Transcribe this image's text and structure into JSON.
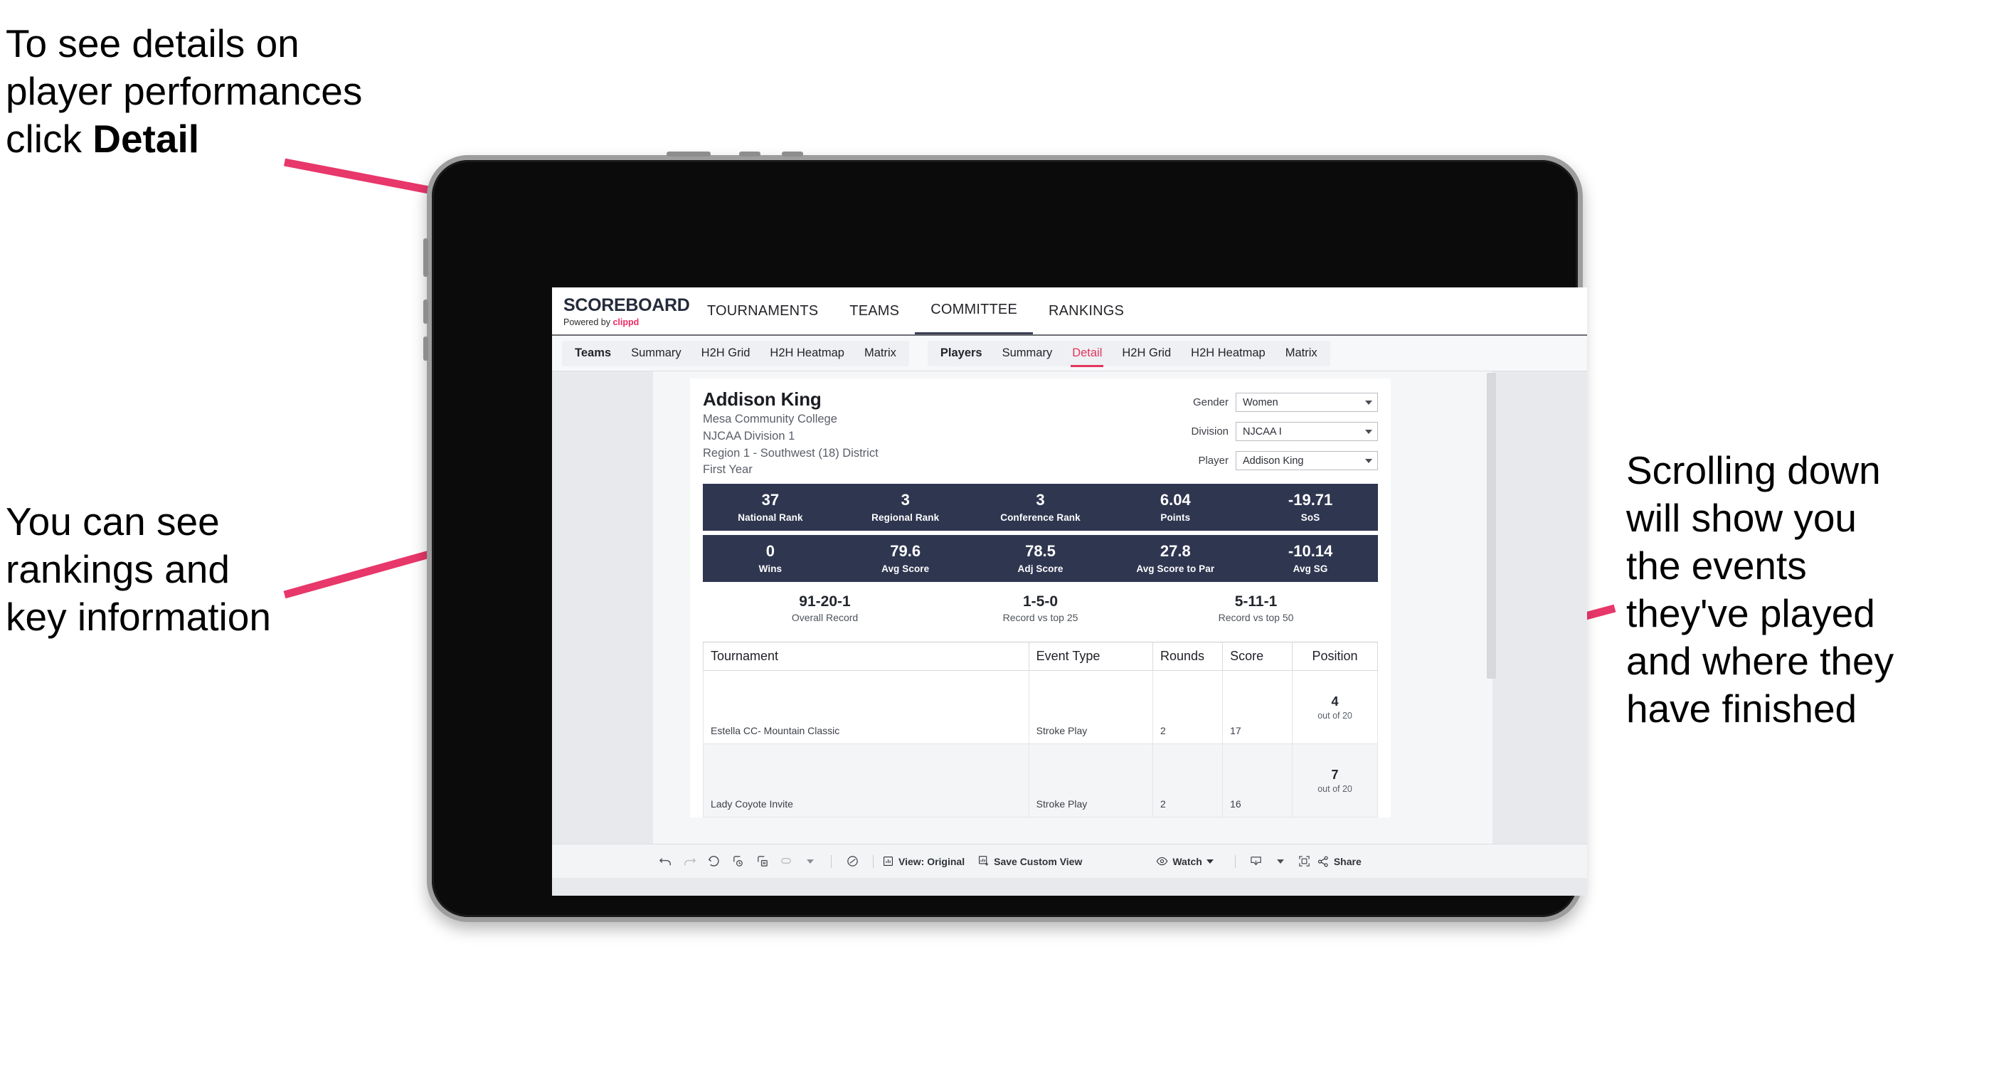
{
  "annotations": {
    "top_left": "To see details on\nplayer performances\nclick ",
    "top_left_bold": "Detail",
    "mid_left": "You can see\nrankings and\nkey information",
    "right": "Scrolling down\nwill show you\nthe events\nthey've played\nand where they\nhave finished",
    "arrow_color": "#e8376a"
  },
  "app": {
    "brand": {
      "title": "SCOREBOARD",
      "powered_prefix": "Powered by ",
      "powered_name": "clippd"
    },
    "topnav": [
      {
        "label": "TOURNAMENTS",
        "active": false
      },
      {
        "label": "TEAMS",
        "active": false
      },
      {
        "label": "COMMITTEE",
        "active": true
      },
      {
        "label": "RANKINGS",
        "active": false
      }
    ],
    "subnav": {
      "group_teams": [
        {
          "label": "Teams",
          "head": true,
          "active": false
        },
        {
          "label": "Summary",
          "head": false,
          "active": false
        },
        {
          "label": "H2H Grid",
          "head": false,
          "active": false
        },
        {
          "label": "H2H Heatmap",
          "head": false,
          "active": false
        },
        {
          "label": "Matrix",
          "head": false,
          "active": false
        }
      ],
      "group_players": [
        {
          "label": "Players",
          "head": true,
          "active": false
        },
        {
          "label": "Summary",
          "head": false,
          "active": false
        },
        {
          "label": "Detail",
          "head": false,
          "active": true
        },
        {
          "label": "H2H Grid",
          "head": false,
          "active": false
        },
        {
          "label": "H2H Heatmap",
          "head": false,
          "active": false
        },
        {
          "label": "Matrix",
          "head": false,
          "active": false
        }
      ]
    }
  },
  "player": {
    "name": "Addison King",
    "school": "Mesa Community College",
    "division": "NJCAA Division 1",
    "region": "Region 1 - Southwest (18) District",
    "year": "First Year"
  },
  "filters": [
    {
      "label": "Gender",
      "value": "Women"
    },
    {
      "label": "Division",
      "value": "NJCAA I"
    },
    {
      "label": "Player",
      "value": "Addison King"
    }
  ],
  "stats_row1": [
    {
      "value": "37",
      "label": "National Rank"
    },
    {
      "value": "3",
      "label": "Regional Rank"
    },
    {
      "value": "3",
      "label": "Conference Rank"
    },
    {
      "value": "6.04",
      "label": "Points"
    },
    {
      "value": "-19.71",
      "label": "SoS"
    }
  ],
  "stats_row2": [
    {
      "value": "0",
      "label": "Wins"
    },
    {
      "value": "79.6",
      "label": "Avg Score"
    },
    {
      "value": "78.5",
      "label": "Adj Score"
    },
    {
      "value": "27.8",
      "label": "Avg Score to Par"
    },
    {
      "value": "-10.14",
      "label": "Avg SG"
    }
  ],
  "records": [
    {
      "value": "91-20-1",
      "label": "Overall Record"
    },
    {
      "value": "1-5-0",
      "label": "Record vs top 25"
    },
    {
      "value": "5-11-1",
      "label": "Record vs top 50"
    }
  ],
  "events_table": {
    "columns": [
      "Tournament",
      "Event Type",
      "Rounds",
      "Score",
      "Position"
    ],
    "rows": [
      {
        "tournament": "Estella CC- Mountain Classic",
        "event_type": "Stroke Play",
        "rounds": "2",
        "score": "17",
        "position": "4",
        "position_sub": "out of 20"
      },
      {
        "tournament": "Lady Coyote Invite",
        "event_type": "Stroke Play",
        "rounds": "2",
        "score": "16",
        "position": "7",
        "position_sub": "out of 20"
      }
    ]
  },
  "toolbar": {
    "view_label": "View: Original",
    "save_label": "Save Custom View",
    "watch_label": "Watch",
    "share_label": "Share"
  },
  "colors": {
    "accent_pink": "#e3345d",
    "stat_bar": "#2f3650",
    "brand_dark": "#252b3b"
  }
}
